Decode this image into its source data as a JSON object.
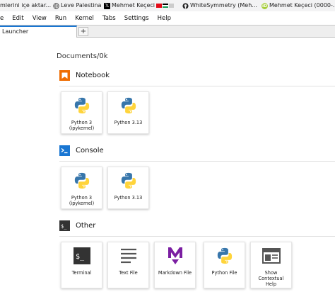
{
  "bookmarks": [
    {
      "label": "mlerini içe aktar...",
      "icon": "none-icon"
    },
    {
      "label": "Leve Palestina",
      "icon": "globe-icon"
    },
    {
      "label": "Mehmet Keçeci",
      "icon": "x-logo-icon"
    },
    {
      "label": "WhiteSymmetry (Meh...",
      "icon": "github-icon"
    },
    {
      "label": "Mehmet Keçeci (0000-...",
      "icon": "orcid-icon"
    }
  ],
  "menu": [
    "e",
    "Edit",
    "View",
    "Run",
    "Kernel",
    "Tabs",
    "Settings",
    "Help"
  ],
  "tabs": {
    "active_label": "Launcher",
    "add_label": "+"
  },
  "launcher": {
    "breadcrumb": "Documents/0k",
    "sections": {
      "notebook": {
        "title": "Notebook",
        "cards": [
          {
            "line1": "Python 3",
            "line2": "(ipykernel)"
          },
          {
            "line1": "Python 3.13",
            "line2": ""
          }
        ]
      },
      "console": {
        "title": "Console",
        "cards": [
          {
            "line1": "Python 3",
            "line2": "(ipykernel)"
          },
          {
            "line1": "Python 3.13",
            "line2": ""
          }
        ]
      },
      "other": {
        "title": "Other",
        "cards": [
          {
            "line1": "Terminal",
            "line2": "",
            "line3": "",
            "icon": "terminal-icon"
          },
          {
            "line1": "Text File",
            "line2": "",
            "line3": "",
            "icon": "text-file-icon"
          },
          {
            "line1": "Markdown File",
            "line2": "",
            "line3": "",
            "icon": "markdown-icon"
          },
          {
            "line1": "Python File",
            "line2": "",
            "line3": "",
            "icon": "python-icon"
          },
          {
            "line1": "Show",
            "line2": "Contextual",
            "line3": "Help",
            "icon": "contextual-help-icon"
          }
        ]
      }
    }
  },
  "colors": {
    "accent": "#1976d2",
    "notebook_icon": "#ef6c00",
    "console_icon": "#1976d2",
    "markdown": "#7b1fa2",
    "python_blue": "#3776ab",
    "python_yellow": "#ffd43b"
  }
}
